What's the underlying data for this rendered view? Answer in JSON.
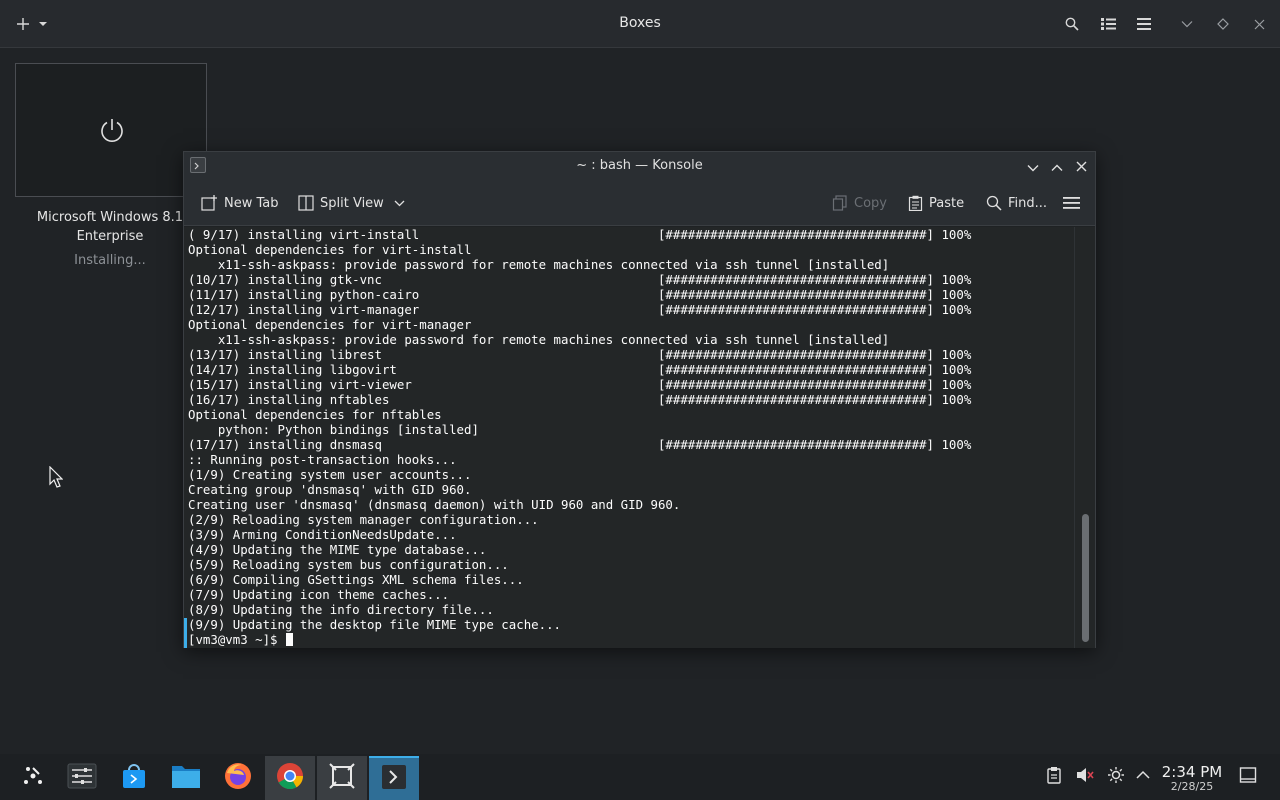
{
  "boxes": {
    "title": "Boxes",
    "add_label": "+",
    "vm": {
      "name_line1": "Microsoft Windows 8.1",
      "name_line2": "Enterprise",
      "status": "Installing..."
    }
  },
  "konsole": {
    "title": "~ : bash — Konsole",
    "toolbar": {
      "new_tab": "New Tab",
      "split_view": "Split View",
      "copy": "Copy",
      "paste": "Paste",
      "find": "Find..."
    },
    "lines": [
      "( 9/17) installing virt-install                                [###################################] 100%",
      "Optional dependencies for virt-install",
      "    x11-ssh-askpass: provide password for remote machines connected via ssh tunnel [installed]",
      "(10/17) installing gtk-vnc                                     [###################################] 100%",
      "(11/17) installing python-cairo                                [###################################] 100%",
      "(12/17) installing virt-manager                                [###################################] 100%",
      "Optional dependencies for virt-manager",
      "    x11-ssh-askpass: provide password for remote machines connected via ssh tunnel [installed]",
      "(13/17) installing librest                                     [###################################] 100%",
      "(14/17) installing libgovirt                                   [###################################] 100%",
      "(15/17) installing virt-viewer                                 [###################################] 100%",
      "(16/17) installing nftables                                    [###################################] 100%",
      "Optional dependencies for nftables",
      "    python: Python bindings [installed]",
      "(17/17) installing dnsmasq                                     [###################################] 100%",
      ":: Running post-transaction hooks...",
      "(1/9) Creating system user accounts...",
      "Creating group 'dnsmasq' with GID 960.",
      "Creating user 'dnsmasq' (dnsmasq daemon) with UID 960 and GID 960.",
      "(2/9) Reloading system manager configuration...",
      "(3/9) Arming ConditionNeedsUpdate...",
      "(4/9) Updating the MIME type database...",
      "(5/9) Reloading system bus configuration...",
      "(6/9) Compiling GSettings XML schema files...",
      "(7/9) Updating icon theme caches...",
      "(8/9) Updating the info directory file...",
      "(9/9) Updating the desktop file MIME type cache..."
    ],
    "prompt": "[vm3@vm3 ~]$ "
  },
  "taskbar": {
    "time": "2:34 PM",
    "date": "2/28/25"
  },
  "colors": {
    "accent": "#3daee9",
    "terminal_bg": "#232627"
  }
}
